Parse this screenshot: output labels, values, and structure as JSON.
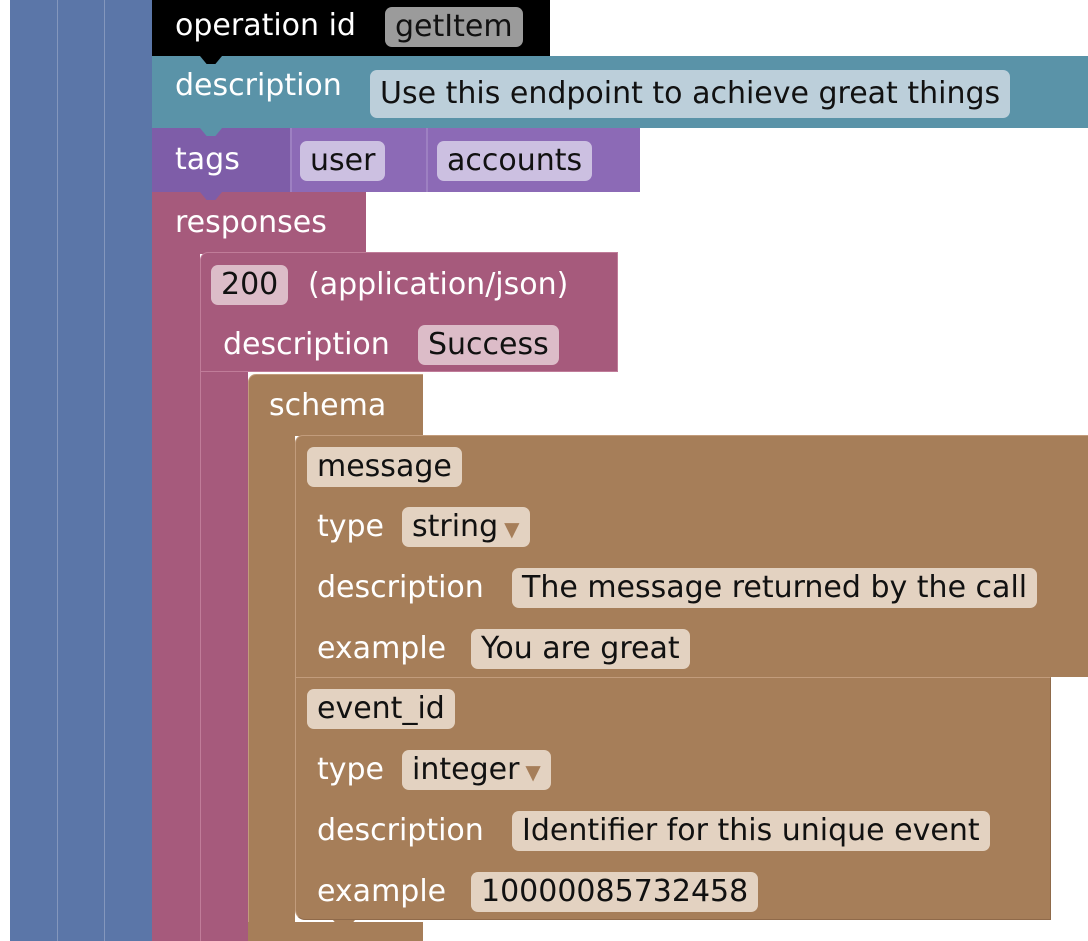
{
  "operation": {
    "label": "operation id",
    "value": "getItem"
  },
  "description": {
    "label": "description",
    "value": "Use this endpoint to achieve great things"
  },
  "tags": {
    "label": "tags",
    "items": [
      "user",
      "accounts"
    ]
  },
  "responses": {
    "label": "responses",
    "response": {
      "code": "200",
      "content_type": "(application/json)",
      "description_label": "description",
      "description_value": "Success",
      "schema": {
        "label": "schema",
        "properties": [
          {
            "name": "message",
            "type_label": "type",
            "type_value": "string",
            "description_label": "description",
            "description_value": "The message returned by the call",
            "example_label": "example",
            "example_value": "You are great"
          },
          {
            "name": "event_id",
            "type_label": "type",
            "type_value": "integer",
            "description_label": "description",
            "description_value": "Identifier for this unique event",
            "example_label": "example",
            "example_value": "10000085732458"
          }
        ]
      }
    }
  },
  "colors": {
    "outer_blocks": "#5b76a8",
    "operation_block": "#000000",
    "description_block": "#5a93a8",
    "tags_block": "#7e5da8",
    "responses_block": "#a65a7c",
    "schema_block": "#a67e59"
  }
}
